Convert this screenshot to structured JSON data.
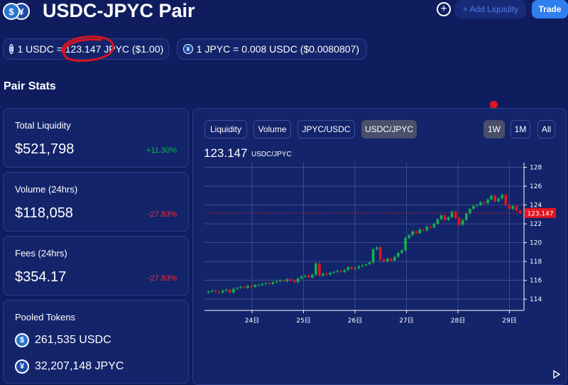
{
  "header": {
    "title": "USDC-JPYC Pair",
    "logo_a_glyph": "$",
    "logo_b_glyph": "¥",
    "add_liquidity_label": "+ Add Liquidity",
    "trade_label": "Trade",
    "plus_glyph": "+"
  },
  "prices": {
    "usdc_to_jpyc": "1 USDC = 123.147 JPYC ($1.00)",
    "jpyc_to_usdc": "1 JPYC = 0.008 USDC ($0.0080807)"
  },
  "pair_stats": {
    "title": "Pair Stats",
    "total_liquidity": {
      "label": "Total Liquidity",
      "value": "$521,798",
      "change": "+11.30%"
    },
    "volume_24h": {
      "label": "Volume (24hrs)",
      "value": "$118,058",
      "change": "-27.83%"
    },
    "fees_24h": {
      "label": "Fees (24hrs)",
      "value": "$354.17",
      "change": "-27.83%"
    },
    "pooled_tokens": {
      "label": "Pooled Tokens",
      "usdc": "261,535 USDC",
      "jpyc": "32,207,148 JPYC"
    }
  },
  "chart_panel": {
    "tabs": [
      "Liquidity",
      "Volume",
      "JPYC/USDC",
      "USDC/JPYC"
    ],
    "active_tab": "USDC/JPYC",
    "ranges": [
      "1W",
      "1M",
      "All"
    ],
    "active_range": "1W",
    "current_price": "123.147",
    "price_unit": "USDC/JPYC"
  },
  "colors": {
    "background": "#0f1d5e",
    "card": "#13246a",
    "up": "#13b24b",
    "down": "#e5141e",
    "accent": "#2f7ff0"
  },
  "chart_data": {
    "type": "candlestick",
    "title": "",
    "xlabel": "",
    "ylabel": "",
    "x_ticks": [
      "24日",
      "25日",
      "26日",
      "27日",
      "28日",
      "29日"
    ],
    "y_ticks": [
      114,
      116,
      118,
      120,
      122,
      124,
      126,
      128
    ],
    "ylim": [
      112.8,
      128.5
    ],
    "last_price_label": "123.147",
    "last_price": 123.147,
    "candles_close": [
      114.8,
      114.9,
      114.8,
      114.7,
      114.9,
      115.0,
      114.7,
      115.1,
      115.2,
      115.3,
      115.2,
      115.4,
      115.3,
      115.5,
      115.5,
      115.6,
      115.7,
      115.6,
      115.8,
      115.9,
      116.0,
      115.9,
      116.1,
      116.0,
      115.8,
      116.2,
      116.4,
      116.5,
      116.3,
      116.6,
      117.8,
      116.5,
      116.7,
      116.6,
      116.8,
      116.9,
      117.0,
      116.9,
      117.1,
      117.4,
      117.2,
      117.3,
      117.5,
      117.6,
      117.7,
      117.9,
      119.3,
      119.5,
      118.2,
      118.0,
      118.3,
      118.1,
      118.5,
      118.9,
      119.2,
      120.5,
      120.8,
      121.2,
      121.0,
      121.4,
      121.3,
      121.7,
      121.6,
      122.0,
      122.5,
      122.9,
      122.4,
      122.7,
      123.3,
      122.6,
      121.9,
      122.4,
      123.1,
      123.6,
      123.9,
      124.0,
      124.3,
      124.2,
      124.6,
      125.0,
      124.4,
      124.7,
      125.1,
      124.0,
      123.6,
      123.9,
      123.4,
      123.147
    ],
    "grid": true
  }
}
